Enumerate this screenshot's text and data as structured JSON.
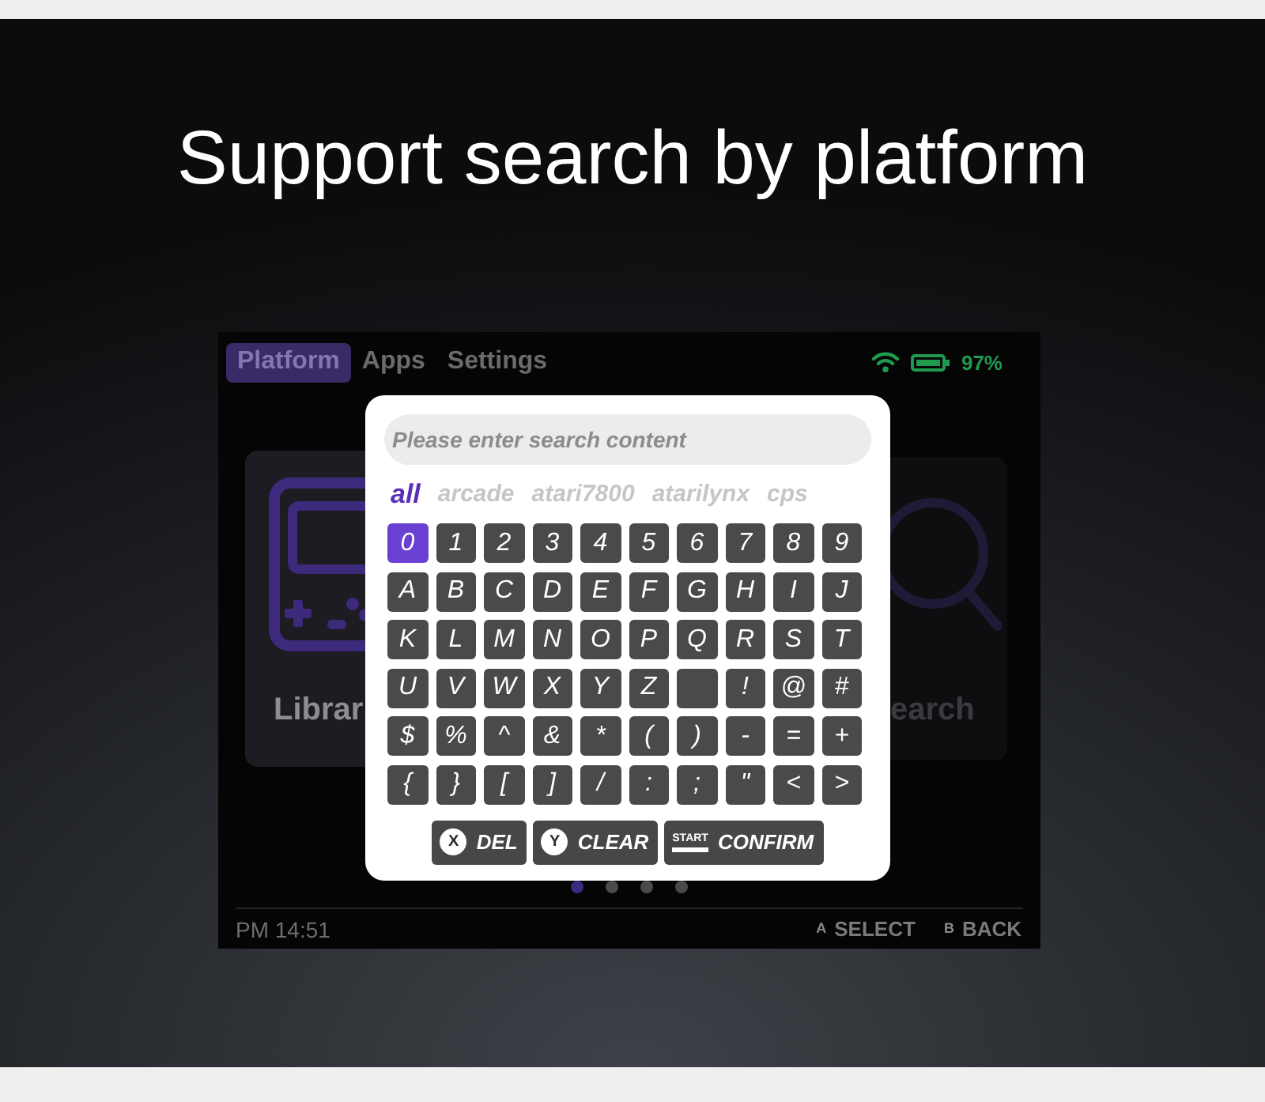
{
  "headline": "Support search by platform",
  "device": {
    "tabs": [
      {
        "label": "Platform",
        "selected": true
      },
      {
        "label": "Apps",
        "selected": false
      },
      {
        "label": "Settings",
        "selected": false
      }
    ],
    "battery": {
      "reading": "97%"
    },
    "cards": [
      {
        "kind": "library",
        "label": "Librar",
        "selected": true
      },
      {
        "kind": "search",
        "label": "earch",
        "selected": false
      }
    ],
    "page_dots": [
      {
        "selected": true
      },
      {
        "selected": false
      },
      {
        "selected": false
      },
      {
        "selected": false
      }
    ],
    "clock": "PM 14:51",
    "hints": [
      {
        "key": "A",
        "label": "SELECT"
      },
      {
        "key": "B",
        "label": "BACK"
      }
    ]
  },
  "search_dialog": {
    "search_field": {
      "placeholder": "Please enter search content"
    },
    "platforms": [
      {
        "label": "all",
        "selected": true
      },
      {
        "label": "arcade",
        "selected": false
      },
      {
        "label": "atari7800",
        "selected": false
      },
      {
        "label": "atarilynx",
        "selected": false
      },
      {
        "label": "cps",
        "selected": false
      }
    ],
    "keyboard": {
      "rows": [
        [
          {
            "kind": "char",
            "label": "0",
            "selected": true
          },
          {
            "kind": "char",
            "label": "1",
            "selected": false
          },
          {
            "kind": "char",
            "label": "2",
            "selected": false
          },
          {
            "kind": "char",
            "label": "3",
            "selected": false
          },
          {
            "kind": "char",
            "label": "4",
            "selected": false
          },
          {
            "kind": "char",
            "label": "5",
            "selected": false
          },
          {
            "kind": "char",
            "label": "6",
            "selected": false
          },
          {
            "kind": "char",
            "label": "7",
            "selected": false
          },
          {
            "kind": "char",
            "label": "8",
            "selected": false
          },
          {
            "kind": "char",
            "label": "9",
            "selected": false
          }
        ],
        [
          {
            "kind": "char",
            "label": "A",
            "selected": false
          },
          {
            "kind": "char",
            "label": "B",
            "selected": false
          },
          {
            "kind": "char",
            "label": "C",
            "selected": false
          },
          {
            "kind": "char",
            "label": "D",
            "selected": false
          },
          {
            "kind": "char",
            "label": "E",
            "selected": false
          },
          {
            "kind": "char",
            "label": "F",
            "selected": false
          },
          {
            "kind": "char",
            "label": "G",
            "selected": false
          },
          {
            "kind": "char",
            "label": "H",
            "selected": false
          },
          {
            "kind": "char",
            "label": "I",
            "selected": false
          },
          {
            "kind": "char",
            "label": "J",
            "selected": false
          }
        ],
        [
          {
            "kind": "char",
            "label": "K",
            "selected": false
          },
          {
            "kind": "char",
            "label": "L",
            "selected": false
          },
          {
            "kind": "char",
            "label": "M",
            "selected": false
          },
          {
            "kind": "char",
            "label": "N",
            "selected": false
          },
          {
            "kind": "char",
            "label": "O",
            "selected": false
          },
          {
            "kind": "char",
            "label": "P",
            "selected": false
          },
          {
            "kind": "char",
            "label": "Q",
            "selected": false
          },
          {
            "kind": "char",
            "label": "R",
            "selected": false
          },
          {
            "kind": "char",
            "label": "S",
            "selected": false
          },
          {
            "kind": "char",
            "label": "T",
            "selected": false
          }
        ],
        [
          {
            "kind": "char",
            "label": "U",
            "selected": false
          },
          {
            "kind": "char",
            "label": "V",
            "selected": false
          },
          {
            "kind": "char",
            "label": "W",
            "selected": false
          },
          {
            "kind": "char",
            "label": "X",
            "selected": false
          },
          {
            "kind": "char",
            "label": "Y",
            "selected": false
          },
          {
            "kind": "char",
            "label": "Z",
            "selected": false
          },
          {
            "kind": "blank",
            "selected": false
          },
          {
            "kind": "char",
            "label": "!",
            "selected": false
          },
          {
            "kind": "char",
            "label": "@",
            "selected": false
          },
          {
            "kind": "char",
            "label": "#",
            "selected": false
          }
        ],
        [
          {
            "kind": "char",
            "label": "$",
            "selected": false
          },
          {
            "kind": "char",
            "label": "%",
            "selected": false
          },
          {
            "kind": "char",
            "label": "^",
            "selected": false
          },
          {
            "kind": "char",
            "label": "&",
            "selected": false
          },
          {
            "kind": "char",
            "label": "*",
            "selected": false
          },
          {
            "kind": "char",
            "label": "(",
            "selected": false
          },
          {
            "kind": "char",
            "label": ")",
            "selected": false
          },
          {
            "kind": "char",
            "label": "-",
            "selected": false
          },
          {
            "kind": "char",
            "label": "=",
            "selected": false
          },
          {
            "kind": "char",
            "label": "+",
            "selected": false
          }
        ],
        [
          {
            "kind": "char",
            "label": "{",
            "selected": false
          },
          {
            "kind": "char",
            "label": "}",
            "selected": false
          },
          {
            "kind": "char",
            "label": "[",
            "selected": false
          },
          {
            "kind": "char",
            "label": "]",
            "selected": false
          },
          {
            "kind": "char",
            "label": "/",
            "selected": false
          },
          {
            "kind": "char",
            "label": ":",
            "selected": false
          },
          {
            "kind": "char",
            "label": ";",
            "selected": false
          },
          {
            "kind": "char",
            "label": "\"",
            "selected": false
          },
          {
            "kind": "char",
            "label": "<",
            "selected": false
          },
          {
            "kind": "char",
            "label": ">",
            "selected": false
          }
        ]
      ]
    },
    "actions": [
      {
        "kind": "round",
        "glyph": "X",
        "label": "DEL"
      },
      {
        "kind": "round",
        "glyph": "Y",
        "label": "CLEAR"
      },
      {
        "kind": "bar",
        "glyph": "START",
        "label": "CONFIRM"
      }
    ]
  }
}
